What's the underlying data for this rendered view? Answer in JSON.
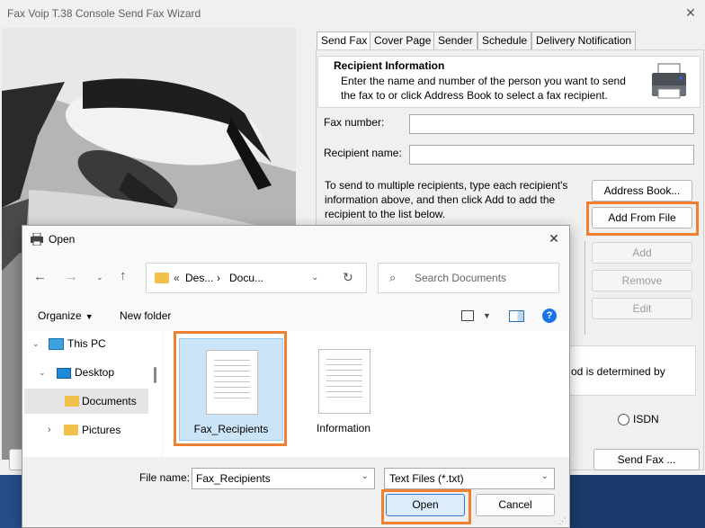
{
  "wizard": {
    "title": "Fax Voip T.38 Console Send Fax Wizard",
    "close_glyph": "✕",
    "tabs": [
      "Send Fax",
      "Cover Page",
      "Sender",
      "Schedule",
      "Delivery Notification"
    ],
    "info_title": "Recipient Information",
    "info_text_1": "Enter the name and number of the person you want to send",
    "info_text_2": "the fax to or click Address Book to select a fax recipient.",
    "fax_number_label": "Fax number:",
    "fax_number_value": "",
    "recipient_name_label": "Recipient name:",
    "recipient_name_value": "",
    "multi_text_1": "To send to multiple recipients, type each recipient's",
    "multi_text_2": "information above, and then click Add to add the",
    "multi_text_3": "recipient to the list below.",
    "address_book_button": "Address Book...",
    "add_from_file_button": "Add From File",
    "add_button": "Add",
    "remove_button": "Remove",
    "edit_button": "Edit",
    "dialing_text_fragment": "od is determined by",
    "isdn_label": "ISDN",
    "send_fax_button": "Send Fax ...",
    "printer_icon": "printer-icon"
  },
  "open_dialog": {
    "title": "Open",
    "close_glyph": "✕",
    "breadcrumb": {
      "chevrons": "«",
      "segment_1": "Des...",
      "separator": "›",
      "segment_2": "Docu..."
    },
    "search_placeholder": "Search Documents",
    "organize_label": "Organize",
    "new_folder_label": "New folder",
    "nav_items": [
      {
        "label": "This PC",
        "icon": "pc-icon"
      },
      {
        "label": "Desktop",
        "icon": "desktop-icon"
      },
      {
        "label": "Documents",
        "icon": "folder-icon"
      },
      {
        "label": "Pictures",
        "icon": "folder-icon"
      }
    ],
    "files": [
      {
        "name": "Fax_Recipients",
        "selected": true
      },
      {
        "name": "Information",
        "selected": false
      }
    ],
    "file_name_label": "File name:",
    "file_name_value": "Fax_Recipients",
    "file_type_value": "Text Files (*.txt)",
    "open_button": "Open",
    "cancel_button": "Cancel"
  },
  "colors": {
    "highlight": "#f07f2f",
    "selection": "#cce4f7",
    "help": "#1a73e8"
  }
}
